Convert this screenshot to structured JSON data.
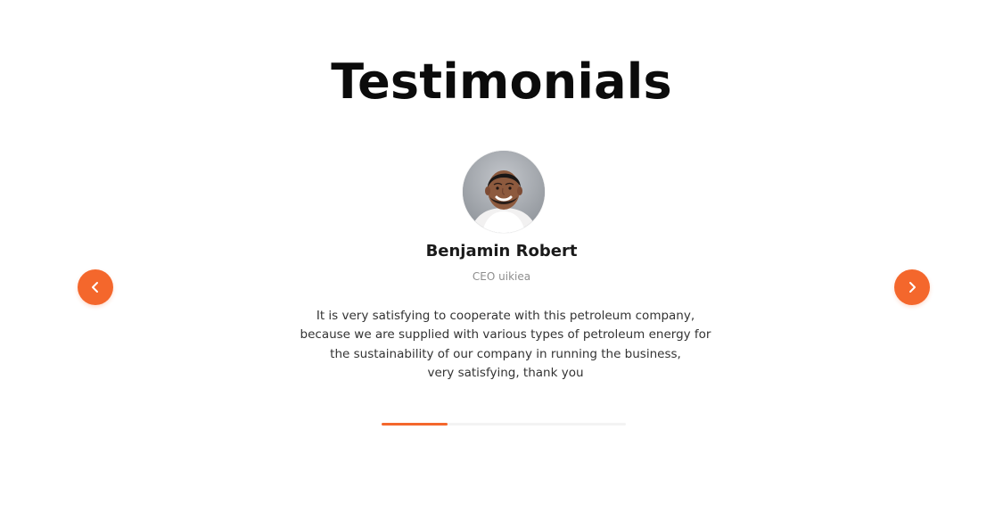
{
  "section": {
    "title": "Testimonials"
  },
  "testimonial": {
    "avatar_icon": "person-avatar",
    "name": "Benjamin Robert",
    "role": "CEO uikiea",
    "quote_lines": [
      "It is very satisfying to cooperate with this petroleum company,",
      "because we are supplied with various types of petroleum energy for",
      "the sustainability of our company in running the business,",
      "very satisfying, thank you"
    ]
  },
  "navigation": {
    "previous_icon": "chevron-left-icon",
    "next_icon": "chevron-right-icon",
    "progress_fraction": 0.27
  },
  "colors": {
    "accent": "#f4672c",
    "title": "#0b0b0b",
    "body_text": "#333333",
    "muted_text": "#8e8e8e",
    "background": "#ffffff"
  }
}
